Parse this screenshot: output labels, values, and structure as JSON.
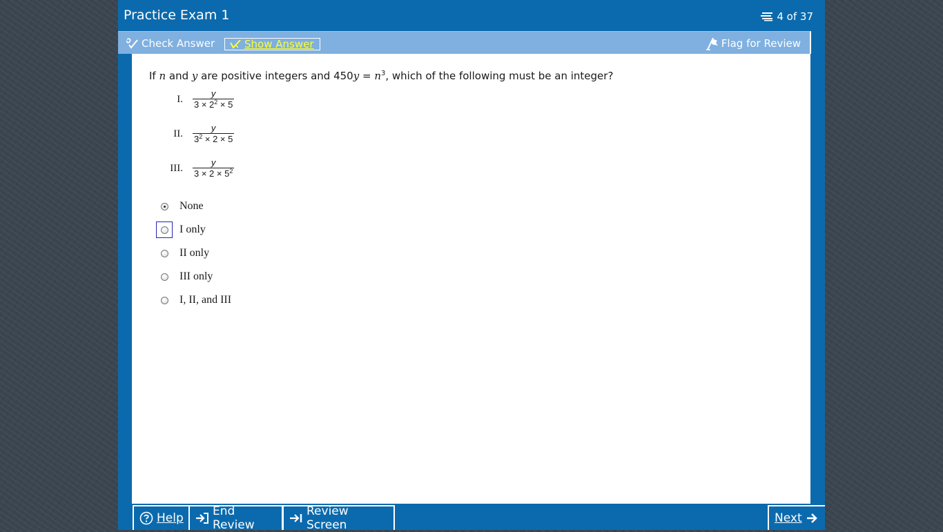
{
  "header": {
    "title": "Practice Exam 1",
    "progress": "4 of 37"
  },
  "toolbar": {
    "check_answer": "Check Answer",
    "show_answer": "Show Answer",
    "flag_review": "Flag for Review"
  },
  "question": {
    "prefix": "If ",
    "var_n": "n",
    "and": " and ",
    "var_y": "y",
    "mid": " are positive integers and 450",
    "var_y2": "y",
    "eq": " = ",
    "var_n2": "n",
    "exp": "3",
    "suffix": ", which of the following must be an integer?",
    "statements": [
      {
        "num": "I.",
        "numerator": "y",
        "den_a": "3 × 2",
        "den_a_sup": "2",
        "den_b": " × 5"
      },
      {
        "num": "II.",
        "numerator": "y",
        "den_a": "3",
        "den_a_sup": "2",
        "den_b": " × 2 × 5"
      },
      {
        "num": "III.",
        "numerator": "y",
        "den_a": "3 × 2 × 5",
        "den_a_sup": "2",
        "den_b": ""
      }
    ]
  },
  "choices": [
    {
      "label": "None",
      "selected": true
    },
    {
      "label": "I only",
      "selected": false
    },
    {
      "label": "II only",
      "selected": false
    },
    {
      "label": "III only",
      "selected": false
    },
    {
      "label": "I, II, and III",
      "selected": false
    }
  ],
  "footer": {
    "help": "Help",
    "end_review": "End Review",
    "review_screen": "Review Screen",
    "next": "Next"
  },
  "icons": {
    "progress": "list-icon",
    "check": "check-answer-icon",
    "show": "show-answer-icon",
    "flag": "flag-icon",
    "help": "help-circle-icon",
    "end": "end-review-icon",
    "review": "review-screen-icon",
    "next": "arrow-right-icon"
  },
  "colors": {
    "frame": "#0b6aad",
    "toolbar": "#7fb0e0",
    "show_answer": "#ffff33"
  }
}
